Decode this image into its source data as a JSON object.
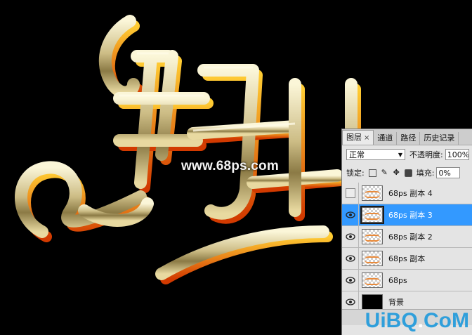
{
  "watermark_site": "www.68ps.com",
  "panel": {
    "tabs": [
      {
        "label": "图层",
        "close": "×"
      },
      {
        "label": "通道"
      },
      {
        "label": "路径"
      },
      {
        "label": "历史记录"
      }
    ],
    "blend_mode": "正常",
    "opacity_label": "不透明度:",
    "opacity_value": "100%",
    "lock_label": "锁定:",
    "fill_label": "填充:",
    "fill_value": "0%",
    "layers": [
      {
        "name": "68ps 副本 4",
        "visible": false,
        "selected": false
      },
      {
        "name": "68ps 副本 3",
        "visible": true,
        "selected": true
      },
      {
        "name": "68ps 副本 2",
        "visible": true,
        "selected": false
      },
      {
        "name": "68ps 副本",
        "visible": true,
        "selected": false
      },
      {
        "name": "68ps",
        "visible": true,
        "selected": false
      },
      {
        "name": "背景",
        "visible": true,
        "selected": false
      }
    ]
  },
  "corner_logo": {
    "left": "UiBQ",
    "dot": ".",
    "right": "CoM"
  },
  "colors": {
    "selection": "#3399ff",
    "text_gold": "#d8c890",
    "text_shadow": "#f08a00"
  }
}
